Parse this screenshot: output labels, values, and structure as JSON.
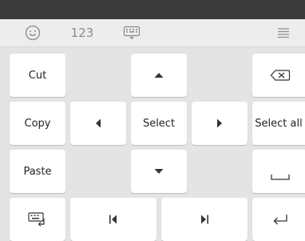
{
  "toolbar": {
    "emoji_icon": "emoji-icon",
    "numbers_label": "123",
    "keyboard_icon": "keyboard-icon",
    "menu_icon": "menu-icon"
  },
  "keys": {
    "cut": "Cut",
    "copy": "Copy",
    "paste": "Paste",
    "select": "Select",
    "select_all": "Select all"
  },
  "icons": {
    "up": "arrow-up-icon",
    "down": "arrow-down-icon",
    "left": "arrow-left-icon",
    "right": "arrow-right-icon",
    "backspace": "backspace-icon",
    "space": "space-icon",
    "enter": "enter-icon",
    "line_start": "line-start-icon",
    "line_end": "line-end-icon",
    "switch_keyboard": "switch-keyboard-icon"
  }
}
